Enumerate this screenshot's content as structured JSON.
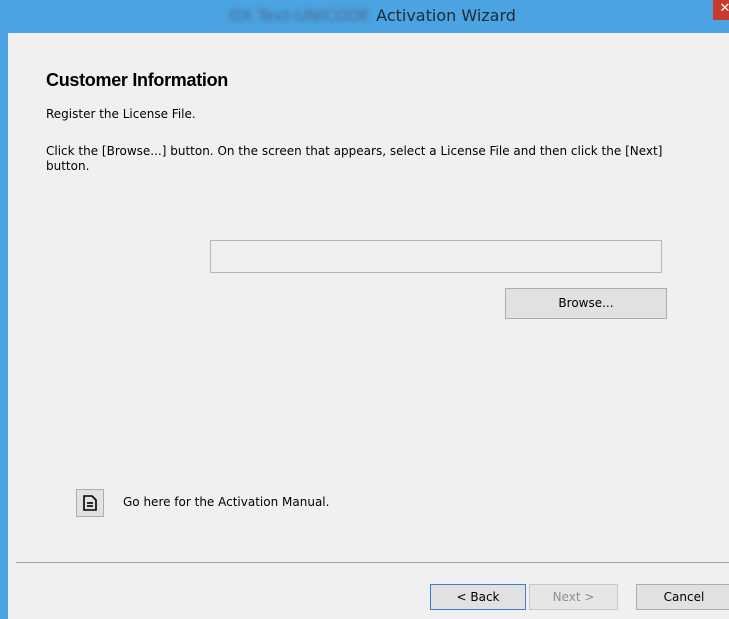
{
  "window": {
    "title_blurred": "DX Text-UNICODE",
    "title": "Activation Wizard",
    "close_label": "✕"
  },
  "page": {
    "heading": "Customer Information",
    "subtext": "Register the License File.",
    "instruction": "Click the [Browse...] button. On the screen that appears, select a License File and then click the [Next] button."
  },
  "file_input": {
    "value": "",
    "placeholder": ""
  },
  "browse": {
    "label": "Browse..."
  },
  "manual": {
    "icon": "document-icon",
    "label": "Go here for the Activation Manual."
  },
  "footer": {
    "back_label": "< Back",
    "next_label": "Next >",
    "next_enabled": false,
    "cancel_label": "Cancel"
  },
  "colors": {
    "titlebar": "#4ba3e2",
    "close": "#c8392e",
    "background": "#f0f0f0",
    "disabled_text": "#8d8d8d"
  }
}
